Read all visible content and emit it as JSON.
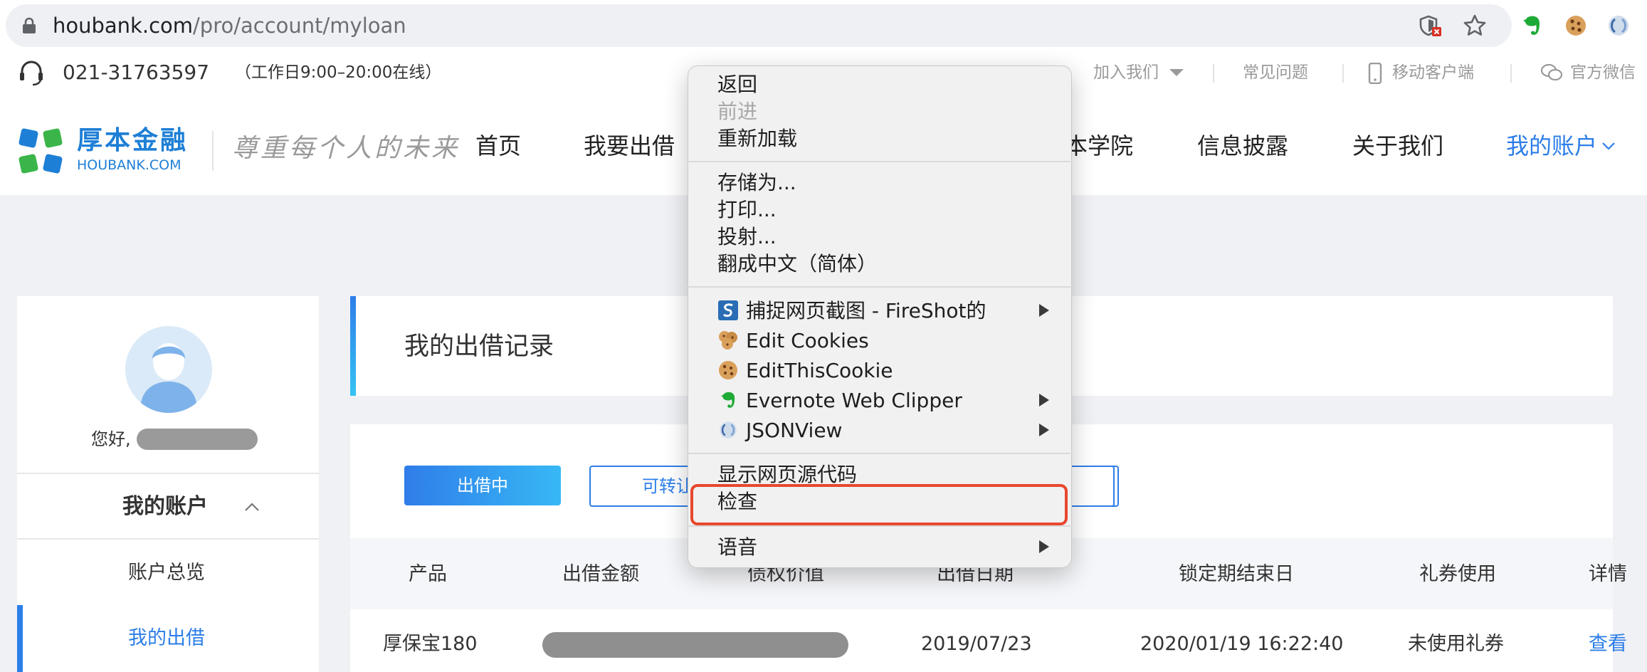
{
  "browser": {
    "url_host": "houbank.com",
    "url_path": "/pro/account/myloan",
    "icons": [
      "lock-icon",
      "shield-blocked-icon",
      "star-icon",
      "evernote-icon",
      "cookie-icon",
      "jsonview-icon"
    ]
  },
  "topbar": {
    "phone": "021-31763597",
    "hours": "（工作日9:00–20:00在线）",
    "join_us": "加入我们",
    "faq": "常见问题",
    "mobile": "移动客户端",
    "wechat": "官方微信"
  },
  "logo": {
    "name_cn": "厚本金融",
    "name_en": "HOUBANK.COM",
    "slogan": "尊重每个人的未来"
  },
  "nav": {
    "home": "首页",
    "lend": "我要出借",
    "academy": "本学院",
    "disclosure": "信息披露",
    "about": "关于我们",
    "account": "我的账户"
  },
  "sidebar": {
    "greeting": "您好,",
    "title": "我的账户",
    "overview": "账户总览",
    "my_lending": "我的出借"
  },
  "records": {
    "title": "我的出借记录",
    "tab_lending": "出借中",
    "tab_transferable": "可转让"
  },
  "table": {
    "headers": {
      "product": "产品",
      "amount": "出借金额",
      "claim_value": "债权价值",
      "date": "出借日期",
      "lock_end": "锁定期结束日",
      "coupon": "礼券使用",
      "detail": "详情"
    },
    "rows": [
      {
        "product": "厚保宝180",
        "date": "2019/07/23",
        "lock_end": "2020/01/19 16:22:40",
        "coupon": "未使用礼券",
        "detail": "查看"
      }
    ]
  },
  "context_menu": {
    "back": "返回",
    "forward": "前进",
    "reload": "重新加载",
    "save_as": "存储为...",
    "print": "打印...",
    "cast": "投射...",
    "translate": "翻成中文（简体）",
    "fireshot": "捕捉网页截图 - FireShot的",
    "edit_cookies": "Edit Cookies",
    "editthiscookie": "EditThisCookie",
    "evernote": "Evernote Web Clipper",
    "jsonview": "JSONView",
    "view_source": "显示网页源代码",
    "inspect": "检查",
    "speech": "语音"
  },
  "colors": {
    "accent_blue": "#2c7ee8",
    "highlight_red": "#e8472e",
    "page_bg": "#f0f1f4"
  }
}
